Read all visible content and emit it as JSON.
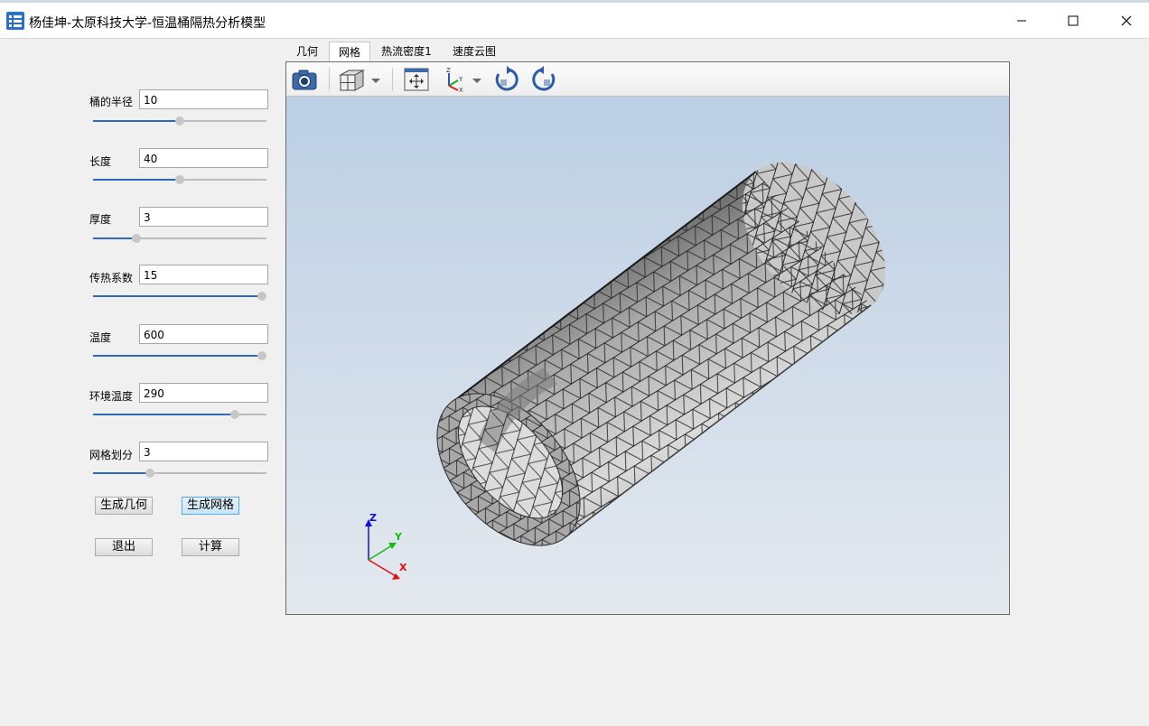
{
  "window": {
    "title": "杨佳坤-太原科技大学-恒温桶隔热分析模型",
    "controls": [
      "minimize-icon",
      "maximize-icon",
      "close-icon"
    ]
  },
  "form": {
    "fields": [
      {
        "label": "桶的半径",
        "value": "10",
        "slider": 0.5
      },
      {
        "label": "长度",
        "value": "40",
        "slider": 0.5
      },
      {
        "label": "厚度",
        "value": "3",
        "slider": 0.25
      },
      {
        "label": "传热系数",
        "value": "15",
        "slider": 1.0
      },
      {
        "label": "温度",
        "value": "600",
        "slider": 1.0
      },
      {
        "label": "环境温度",
        "value": "290",
        "slider": 0.82
      },
      {
        "label": "网格划分",
        "value": "3",
        "slider": 0.33
      }
    ],
    "buttons": {
      "generate_geometry": "生成几何",
      "generate_mesh": "生成网格",
      "exit": "退出",
      "compute": "计算"
    }
  },
  "tabs": [
    {
      "label": "几何",
      "active": false
    },
    {
      "label": "网格",
      "active": true
    },
    {
      "label": "热流密度1",
      "active": false
    },
    {
      "label": "速度云图",
      "active": false
    }
  ],
  "toolbar": {
    "buttons": [
      "camera-icon",
      "view-cube-icon",
      "fit-view-icon",
      "axis-orientation-icon",
      "rotate-cw-icon",
      "rotate-ccw-icon"
    ]
  },
  "axes_triad": {
    "x": "X",
    "y": "Y",
    "z": "Z"
  },
  "colors": {
    "accent": "#2d6ab8",
    "viewport_top": "#b9cde3",
    "viewport_bottom": "#e4e9ef",
    "mesh_edge": "#2b2b2b",
    "x_axis": "#e01010",
    "y_axis": "#10c010",
    "z_axis": "#1010e0"
  }
}
